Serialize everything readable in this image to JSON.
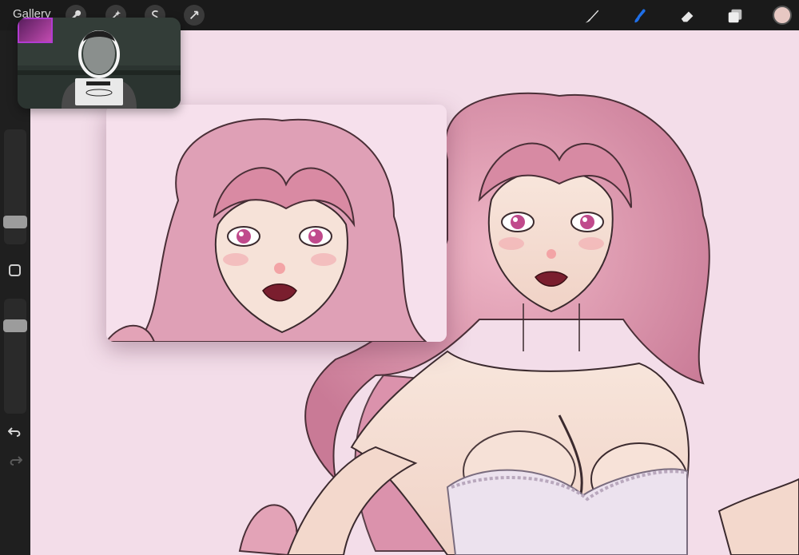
{
  "app": {
    "gallery_label": "Gallery"
  },
  "toolbar": {
    "left_actions": [
      {
        "name": "actions",
        "icon": "wrench-icon"
      },
      {
        "name": "adjustments",
        "icon": "magic-wand-icon"
      },
      {
        "name": "selection",
        "icon": "selection-s-icon"
      },
      {
        "name": "transform",
        "icon": "arrow-cursor-icon"
      }
    ],
    "right_tools": [
      {
        "name": "brush",
        "icon": "brush-icon",
        "active": false
      },
      {
        "name": "smudge",
        "icon": "smudge-finger-icon",
        "active": true
      },
      {
        "name": "eraser",
        "icon": "eraser-icon",
        "active": false
      },
      {
        "name": "layers",
        "icon": "layers-icon",
        "active": false
      }
    ],
    "current_color": "#e7c8c3",
    "active_tool_color": "#1f6fe8"
  },
  "sidebar": {
    "brush_size_level": 0.15,
    "opacity_level": 0.1,
    "modify_icon": "square-modify-icon",
    "undo_icon": "undo-icon",
    "redo_icon": "redo-icon"
  },
  "video_call": {
    "participant_icon": "person-video-icon",
    "self_view_icon": "self-view-thumbnail"
  },
  "artwork": {
    "canvas_bg": "#f3dde9",
    "hair_color": "#d892a8",
    "skin_color": "#f5dfd5",
    "lip_color": "#7a1e2e"
  }
}
